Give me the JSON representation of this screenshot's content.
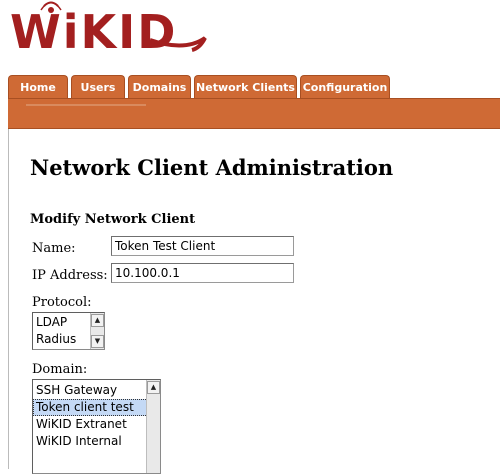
{
  "brand": {
    "logo_text": "WiKID",
    "logo_color": "#a31f1f"
  },
  "nav": {
    "tabs": [
      {
        "label": "Home"
      },
      {
        "label": "Users"
      },
      {
        "label": "Domains"
      },
      {
        "label": "Network Clients"
      },
      {
        "label": "Configuration"
      }
    ],
    "accent_color": "#cf6a35"
  },
  "page": {
    "title": "Network Client Administration",
    "section_title": "Modify Network Client"
  },
  "form": {
    "name_label": "Name:",
    "name_value": "Token Test Client",
    "ip_label": "IP Address:",
    "ip_value": "10.100.0.1",
    "protocol_label": "Protocol:",
    "protocol_options": [
      "LDAP",
      "Radius"
    ],
    "domain_label": "Domain:",
    "domain_options": [
      "SSH Gateway",
      "Token client test",
      "WiKID Extranet",
      "WiKID Internal"
    ],
    "domain_selected": "Token client test"
  }
}
